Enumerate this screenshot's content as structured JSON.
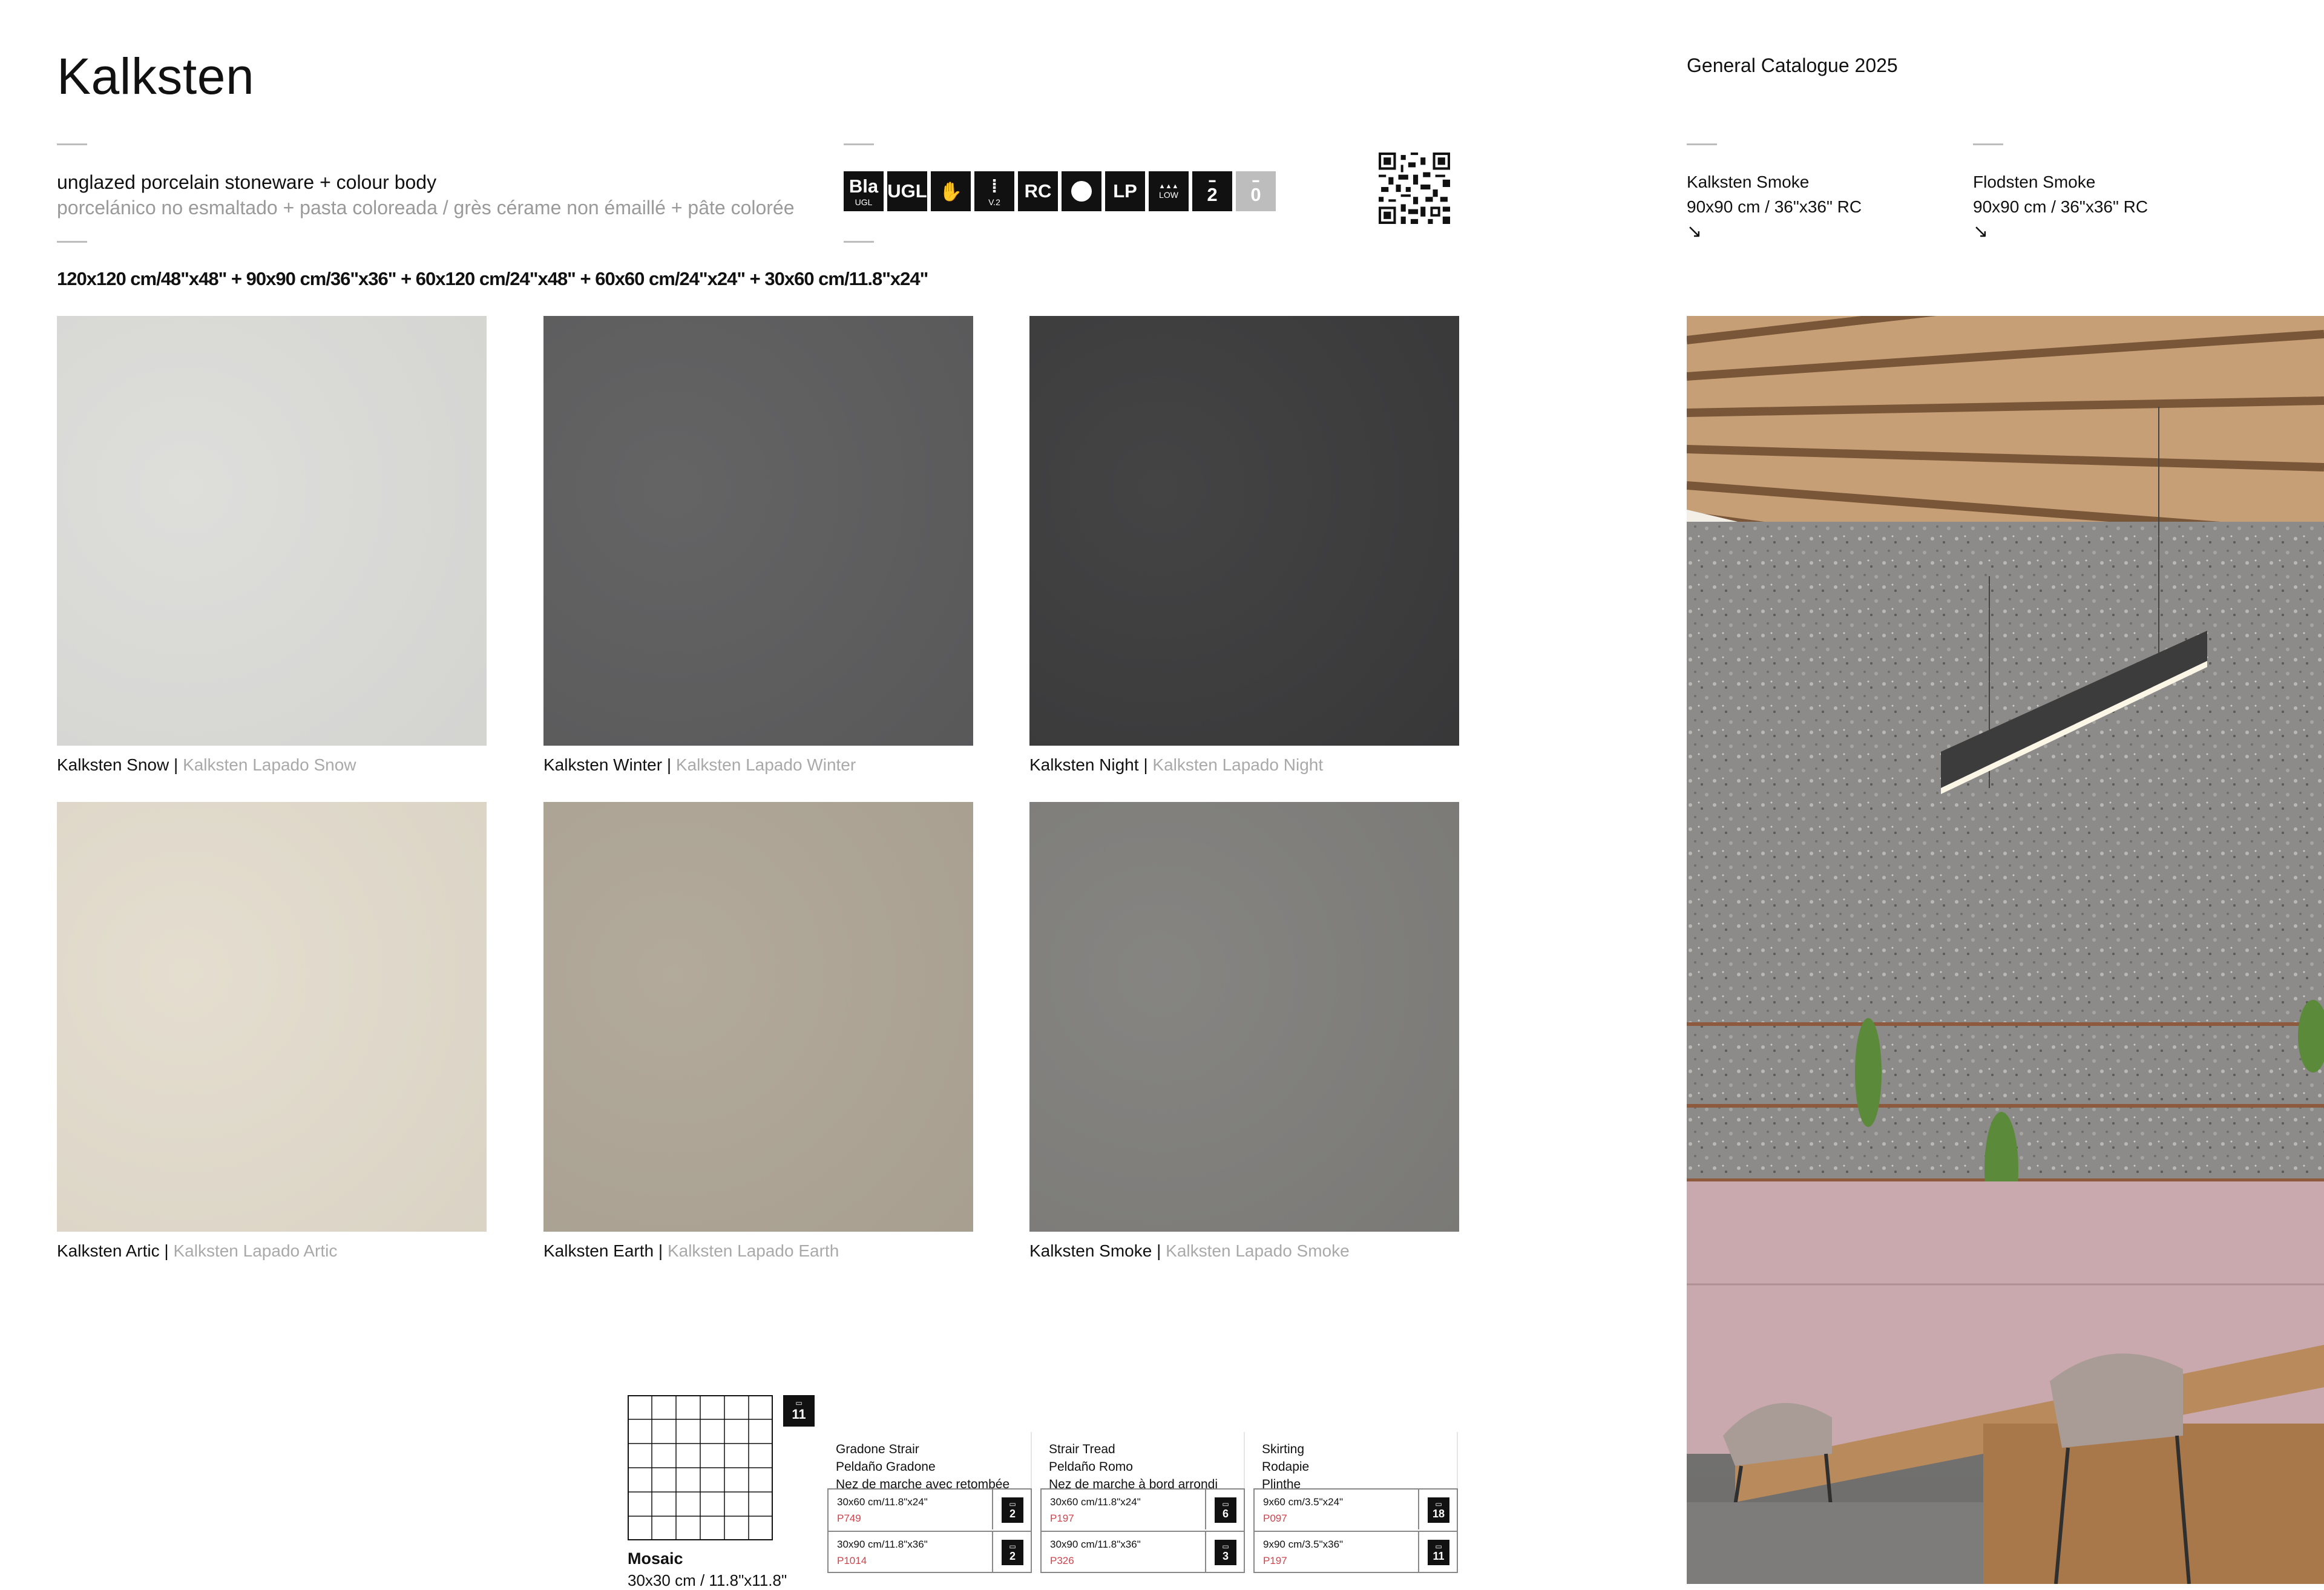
{
  "header": {
    "title": "Kalksten",
    "catalogue": "General Catalogue 2025",
    "material_en": "unglazed porcelain stoneware + colour body",
    "material_other": "porcelánico no esmaltado + pasta coloreada / grès cérame non émaillé + pâte colorée",
    "formats": "120x120 cm/48\"x48\" + 90x90 cm/36\"x36\" + 60x120 cm/24\"x48\" + 60x60 cm/24\"x24\" + 30x60 cm/11.8\"x24\""
  },
  "tech_icons": [
    {
      "name": "bla-icon",
      "label": "Bla",
      "sub": "UGL"
    },
    {
      "name": "ugl-icon",
      "label": "UGL",
      "sub": ""
    },
    {
      "name": "hand-icon",
      "label": "✋",
      "sub": ""
    },
    {
      "name": "variation-icon",
      "label": "⁞",
      "sub": "V.2"
    },
    {
      "name": "rc-icon",
      "label": "RC",
      "sub": ""
    },
    {
      "name": "dot-icon",
      "label": "",
      "sub": ""
    },
    {
      "name": "lp-icon",
      "label": "LP",
      "sub": ""
    },
    {
      "name": "low-icon",
      "label": "",
      "sub": "LOW"
    },
    {
      "name": "shoe-2-icon",
      "label": "2",
      "sub": ""
    },
    {
      "name": "shoe-0-icon",
      "label": "0",
      "sub": ""
    }
  ],
  "tiles": [
    {
      "name": "Kalksten Snow",
      "lapado": "Kalksten Lapado Snow",
      "color": "#dcdcd9"
    },
    {
      "name": "Kalksten Winter",
      "lapado": "Kalksten Lapado Winter",
      "color": "#5c5c5d"
    },
    {
      "name": "Kalksten Night",
      "lapado": "Kalksten Lapado Night",
      "color": "#3a3a3b"
    },
    {
      "name": "Kalksten Artic",
      "lapado": "Kalksten Lapado Artic",
      "color": "#e3dccd"
    },
    {
      "name": "Kalksten Earth",
      "lapado": "Kalksten Lapado Earth",
      "color": "#aea595"
    },
    {
      "name": "Kalksten Smoke",
      "lapado": "Kalksten Lapado Smoke",
      "color": "#7f7e7b"
    }
  ],
  "ambience": [
    {
      "name": "Kalksten Smoke",
      "size": "90x90 cm / 36\"x36\" RC",
      "arrow": "↘"
    },
    {
      "name": "Flodsten Smoke",
      "size": "90x90 cm / 36\"x36\" RC",
      "arrow": "↘"
    }
  ],
  "mosaic": {
    "label": "Mosaic",
    "size": "30x30 cm / 11.8\"x11.8\"",
    "badge": "11"
  },
  "pieces": [
    {
      "head": [
        "Gradone Strair",
        "Peldaño Gradone",
        "Nez de marche avec retombée"
      ],
      "rows": [
        {
          "size": "30x60 cm/11.8\"x24\"",
          "code": "P749",
          "badge": "2"
        },
        {
          "size": "30x90 cm/11.8\"x36\"",
          "code": "P1014",
          "badge": "2"
        }
      ]
    },
    {
      "head": [
        "Strair Tread",
        "Peldaño Romo",
        "Nez de marche à bord arrondi"
      ],
      "rows": [
        {
          "size": "30x60 cm/11.8\"x24\"",
          "code": "P197",
          "badge": "6"
        },
        {
          "size": "30x90 cm/11.8\"x36\"",
          "code": "P326",
          "badge": "3"
        }
      ]
    },
    {
      "head": [
        "Skirting",
        "Rodapie",
        "Plinthe"
      ],
      "rows": [
        {
          "size": "9x60 cm/3.5\"x24\"",
          "code": "P097",
          "badge": "18"
        },
        {
          "size": "9x90 cm/3.5\"x36\"",
          "code": "P197",
          "badge": "11"
        }
      ]
    }
  ],
  "colors": {
    "accent_code": "#d0434d",
    "rule": "#bdbdbd"
  }
}
